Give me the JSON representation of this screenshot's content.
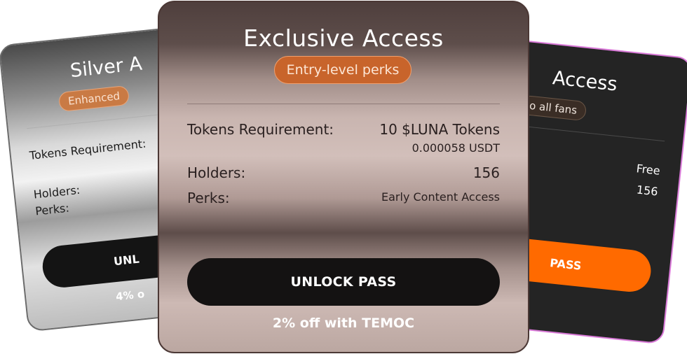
{
  "left_card": {
    "title": "Silver A",
    "badge": "Enhanced",
    "tokens_label": "Tokens Requirement:",
    "holders_label": "Holders:",
    "perks_label": "Perks:",
    "button": "UNL",
    "discount": "4% o"
  },
  "center_card": {
    "title": "Exclusive Access",
    "badge": "Entry-level perks",
    "tokens_label": "Tokens Requirement:",
    "tokens_value": "10 $LUNA Tokens",
    "tokens_usdt": "0.000058 USDT",
    "holders_label": "Holders:",
    "holders_value": "156",
    "perks_label": "Perks:",
    "perks_value": "Early Content Access",
    "button": "UNLOCK PASS",
    "discount": "2% off with TEMOC"
  },
  "right_card": {
    "title": "Access",
    "badge": "o all fans",
    "tokens_value": "Free",
    "holders_value": "156",
    "button": "PASS"
  },
  "colors": {
    "badge_orange": "#c8642b",
    "button_dark": "#141212",
    "button_orange": "#ff6a00",
    "right_border": "#d97ad8"
  }
}
